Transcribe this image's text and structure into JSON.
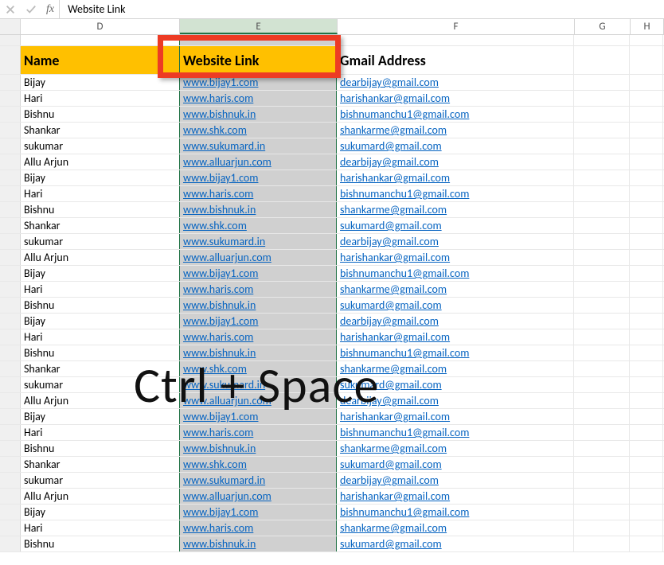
{
  "formula_bar": {
    "value": "Website Link",
    "fx_label": "fx"
  },
  "columns": {
    "D": "D",
    "E": "E",
    "F": "F",
    "G": "G",
    "H": "H"
  },
  "headers": {
    "name": "Name",
    "website": "Website Link",
    "gmail": "Gmail Address"
  },
  "overlay": "Ctrl + Space",
  "rows": [
    {
      "name": "Bijay",
      "web": "www.bijay1.com",
      "mail": "dearbijay@gmail.com"
    },
    {
      "name": "Hari",
      "web": "www.haris.com",
      "mail": "harishankar@gmail.com"
    },
    {
      "name": "Bishnu",
      "web": "www.bishnuk.in",
      "mail": "bishnumanchu1@gmail.com"
    },
    {
      "name": "Shankar",
      "web": "www.shk.com",
      "mail": "shankarme@gmail.com"
    },
    {
      "name": "sukumar",
      "web": "www.sukumard.in",
      "mail": "sukumard@gmail.com"
    },
    {
      "name": "Allu Arjun",
      "web": "www.alluarjun.com",
      "mail": "dearbijay@gmail.com"
    },
    {
      "name": "Bijay",
      "web": "www.bijay1.com",
      "mail": "harishankar@gmail.com"
    },
    {
      "name": "Hari",
      "web": "www.haris.com",
      "mail": "bishnumanchu1@gmail.com"
    },
    {
      "name": "Bishnu",
      "web": "www.bishnuk.in",
      "mail": "shankarme@gmail.com"
    },
    {
      "name": "Shankar",
      "web": "www.shk.com",
      "mail": "sukumard@gmail.com"
    },
    {
      "name": "sukumar",
      "web": "www.sukumard.in",
      "mail": "dearbijay@gmail.com"
    },
    {
      "name": "Allu Arjun",
      "web": "www.alluarjun.com",
      "mail": "harishankar@gmail.com"
    },
    {
      "name": "Bijay",
      "web": "www.bijay1.com",
      "mail": "bishnumanchu1@gmail.com"
    },
    {
      "name": "Hari",
      "web": "www.haris.com",
      "mail": "shankarme@gmail.com"
    },
    {
      "name": "Bishnu",
      "web": "www.bishnuk.in",
      "mail": "sukumard@gmail.com"
    },
    {
      "name": "Bijay",
      "web": "www.bijay1.com",
      "mail": "dearbijay@gmail.com"
    },
    {
      "name": "Hari",
      "web": "www.haris.com",
      "mail": "harishankar@gmail.com"
    },
    {
      "name": "Bishnu",
      "web": "www.bishnuk.in",
      "mail": "bishnumanchu1@gmail.com"
    },
    {
      "name": "Shankar",
      "web": "www.shk.com",
      "mail": "shankarme@gmail.com"
    },
    {
      "name": "sukumar",
      "web": "www.sukumard.in",
      "mail": "sukumard@gmail.com"
    },
    {
      "name": "Allu Arjun",
      "web": "www.alluarjun.com",
      "mail": "dearbijay@gmail.com"
    },
    {
      "name": "Bijay",
      "web": "www.bijay1.com",
      "mail": "harishankar@gmail.com"
    },
    {
      "name": "Hari",
      "web": "www.haris.com",
      "mail": "bishnumanchu1@gmail.com"
    },
    {
      "name": "Bishnu",
      "web": "www.bishnuk.in",
      "mail": "shankarme@gmail.com"
    },
    {
      "name": "Shankar",
      "web": "www.shk.com",
      "mail": "sukumard@gmail.com"
    },
    {
      "name": "sukumar",
      "web": "www.sukumard.in",
      "mail": "dearbijay@gmail.com"
    },
    {
      "name": "Allu Arjun",
      "web": "www.alluarjun.com",
      "mail": "harishankar@gmail.com"
    },
    {
      "name": "Bijay",
      "web": "www.bijay1.com",
      "mail": "bishnumanchu1@gmail.com"
    },
    {
      "name": "Hari",
      "web": "www.haris.com",
      "mail": "shankarme@gmail.com"
    },
    {
      "name": "Bishnu",
      "web": "www.bishnuk.in",
      "mail": "sukumard@gmail.com"
    }
  ]
}
